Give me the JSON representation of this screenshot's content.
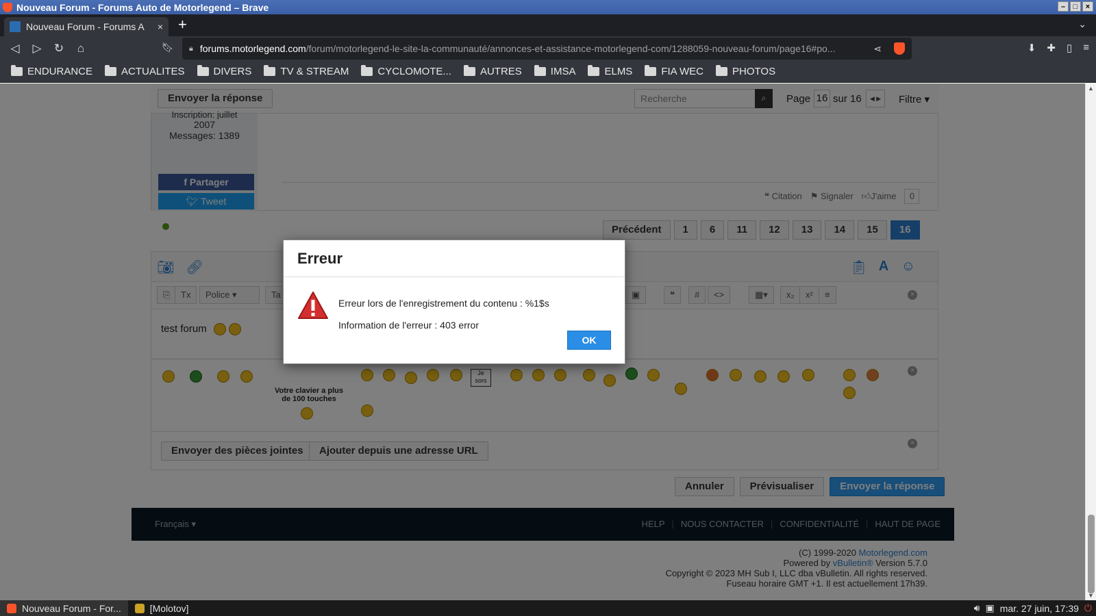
{
  "window": {
    "title": "Nouveau Forum - Forums Auto de Motorlegend – Brave"
  },
  "tab": {
    "title": "Nouveau Forum - Forums A",
    "close": "×"
  },
  "url": {
    "host": "forums.motorlegend.com",
    "path": "/forum/motorlegend-le-site-la-communauté/annonces-et-assistance-motorlegend-com/1288059-nouveau-forum/page16#po..."
  },
  "bookmarks": [
    "ENDURANCE",
    "ACTUALITES",
    "DIVERS",
    "TV & STREAM",
    "CYCLOMOTE...",
    "AUTRES",
    "IMSA",
    "ELMS",
    "FIA WEC",
    "PHOTOS"
  ],
  "topbar": {
    "reply_label": "Envoyer la réponse",
    "search_placeholder": "Recherche",
    "page_label": "Page",
    "page_current": "16",
    "page_of": "sur 16",
    "filter": "Filtre ▾"
  },
  "post": {
    "join_partial": "Inscription: juillet",
    "join_year": "2007",
    "messages": "Messages: 1389",
    "share_fb": "Partager",
    "share_tw": "Tweet",
    "actions": {
      "quote": "Citation",
      "report": "Signaler",
      "like": "J'aime",
      "like_count": "0"
    }
  },
  "pagination": [
    "Précédent",
    "1",
    "6",
    "11",
    "12",
    "13",
    "14",
    "15",
    "16"
  ],
  "editor": {
    "font_select": "Police",
    "size_select": "Ta",
    "body_text": "test forum",
    "keyboard_text": "Votre clavier a plus de 100 touches",
    "sign_text": "Je sors",
    "attach_button": "Envoyer des pièces jointes",
    "url_button": "Ajouter depuis une adresse URL"
  },
  "actions": {
    "cancel": "Annuler",
    "preview": "Prévisualiser",
    "submit": "Envoyer la réponse"
  },
  "footer": {
    "language": "Français ▾",
    "links": [
      "HELP",
      "NOUS CONTACTER",
      "CONFIDENTIALITÉ",
      "HAUT DE PAGE"
    ],
    "copyright1_prefix": "(C) 1999-2020 ",
    "copyright1_link": "Motorlegend.com",
    "powered_prefix": "Powered by ",
    "powered_link": "vBulletin®",
    "powered_suffix": " Version 5.7.0",
    "copyright2": "Copyright © 2023 MH Sub I, LLC dba vBulletin. All rights reserved.",
    "timezone": "Fuseau horaire GMT +1. Il est actuellement 17h39."
  },
  "modal": {
    "title": "Erreur",
    "line1": "Erreur lors de l'enregistrement du contenu : %1$s",
    "line2": "Information de l'erreur : 403 error",
    "ok": "OK"
  },
  "taskbar": {
    "task1": "Nouveau Forum - For...",
    "task2": "[Molotov]",
    "clock": "mar. 27 juin, 17:39"
  },
  "colors": {
    "accent": "#2b8ee6",
    "footer_bg": "#0b1a24",
    "warning": "#d32f2f"
  }
}
